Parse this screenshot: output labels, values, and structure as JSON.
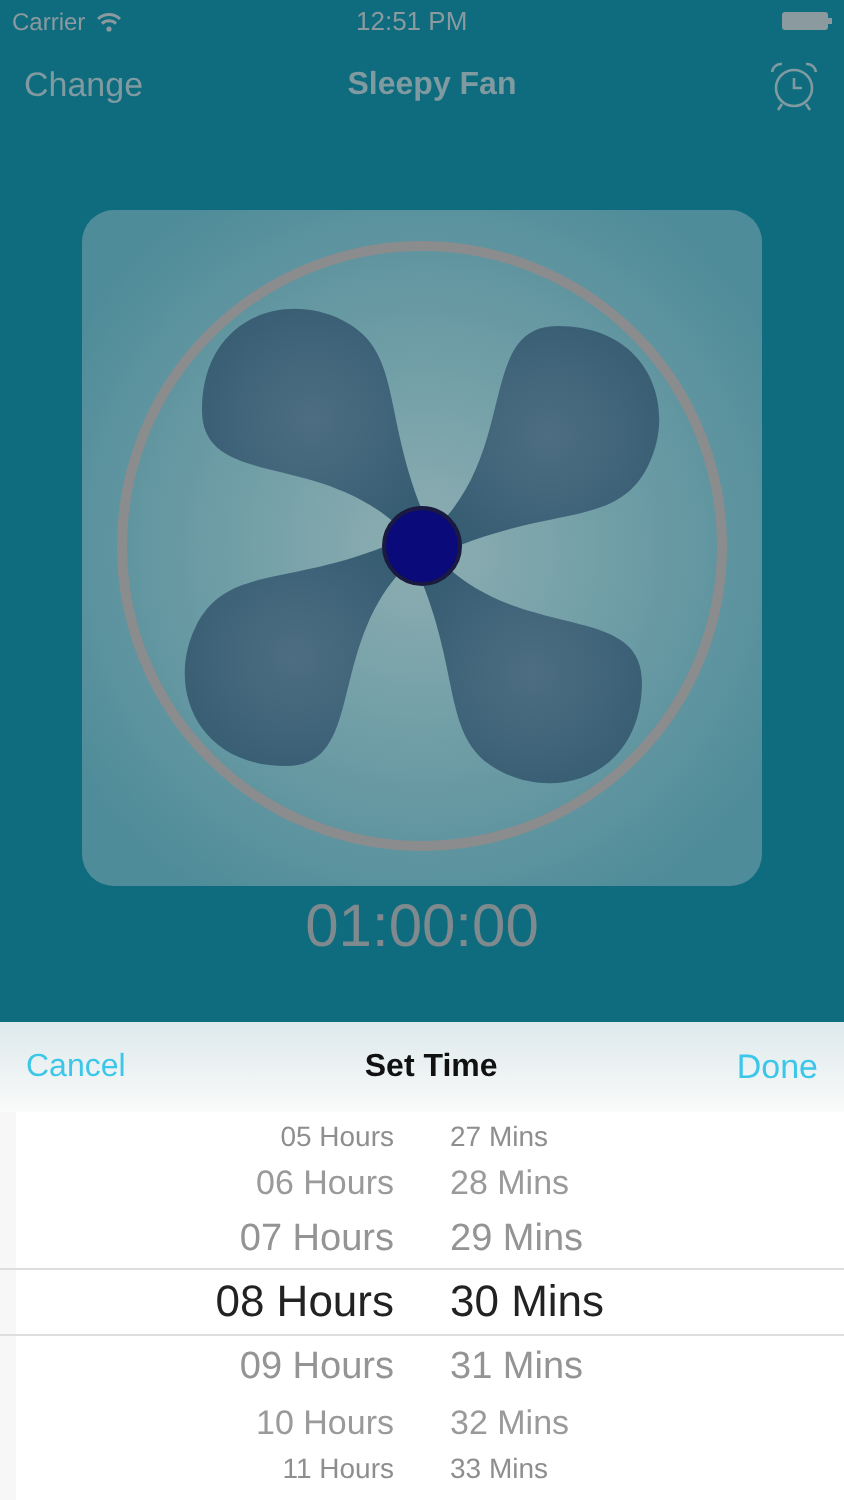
{
  "status_bar": {
    "carrier": "Carrier",
    "time": "12:51 PM"
  },
  "nav": {
    "left": "Change",
    "title": "Sleepy Fan"
  },
  "timer": "01:00:00",
  "sheet": {
    "cancel": "Cancel",
    "title": "Set Time",
    "done": "Done"
  },
  "picker": {
    "rows": [
      {
        "hours": "05 Hours",
        "mins": "27 Mins",
        "selected": false
      },
      {
        "hours": "06 Hours",
        "mins": "28 Mins",
        "selected": false
      },
      {
        "hours": "07 Hours",
        "mins": "29 Mins",
        "selected": false
      },
      {
        "hours": "08 Hours",
        "mins": "30 Mins",
        "selected": true
      },
      {
        "hours": "09 Hours",
        "mins": "31 Mins",
        "selected": false
      },
      {
        "hours": "10 Hours",
        "mins": "32 Mins",
        "selected": false
      },
      {
        "hours": "11 Hours",
        "mins": "33 Mins",
        "selected": false
      }
    ]
  }
}
